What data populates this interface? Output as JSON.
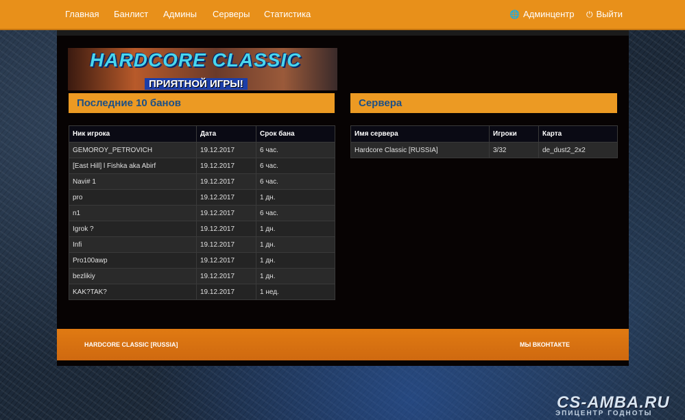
{
  "nav": {
    "items": [
      {
        "label": "Главная"
      },
      {
        "label": "Банлист"
      },
      {
        "label": "Админы"
      },
      {
        "label": "Серверы"
      },
      {
        "label": "Статистика"
      }
    ],
    "admin_center": "Админцентр",
    "logout": "Выйти"
  },
  "banner": {
    "title": "HARDCORE CLASSIC",
    "subtitle": "ПРИЯТНОЙ ИГРЫ!"
  },
  "bans": {
    "title": "Последние 10 банов",
    "headers": [
      "Ник игрока",
      "Дата",
      "Срок бана"
    ],
    "rows": [
      {
        "nick": "GEMOROY_PETROVICH",
        "date": "19.12.2017",
        "term": "6 час."
      },
      {
        "nick": "[East Hill] l Fishka aka Abirf",
        "date": "19.12.2017",
        "term": "6 час."
      },
      {
        "nick": "Navi# 1",
        "date": "19.12.2017",
        "term": "6 час."
      },
      {
        "nick": "pro",
        "date": "19.12.2017",
        "term": "1 дн."
      },
      {
        "nick": "n1",
        "date": "19.12.2017",
        "term": "6 час."
      },
      {
        "nick": "Igrok ?",
        "date": "19.12.2017",
        "term": "1 дн."
      },
      {
        "nick": "Infi",
        "date": "19.12.2017",
        "term": "1 дн."
      },
      {
        "nick": "Pro100awp",
        "date": "19.12.2017",
        "term": "1 дн."
      },
      {
        "nick": "bezlikiy",
        "date": "19.12.2017",
        "term": "1 дн."
      },
      {
        "nick": "KAK?TAK?",
        "date": "19.12.2017",
        "term": "1 нед."
      }
    ]
  },
  "servers": {
    "title": "Сервера",
    "headers": [
      "Имя сервера",
      "Игроки",
      "Карта"
    ],
    "rows": [
      {
        "name": "Hardcore Classic [RUSSIA]",
        "players": "3/32",
        "map": "de_dust2_2x2"
      }
    ]
  },
  "footer": {
    "left": "HARDCORE CLASSIC [RUSSIA]",
    "right": "МЫ ВКОНТАКТЕ"
  },
  "watermark": {
    "main": "CS-AMBA.RU",
    "sub": "ЭПИЦЕНТР ГОДНОТЫ"
  },
  "colors": {
    "accent": "#e8901a",
    "section_title": "#1b4f86",
    "footer": "#d8700f",
    "panel": "#070303"
  },
  "icons": {
    "admin": "globe-icon",
    "logout": "power-icon"
  }
}
